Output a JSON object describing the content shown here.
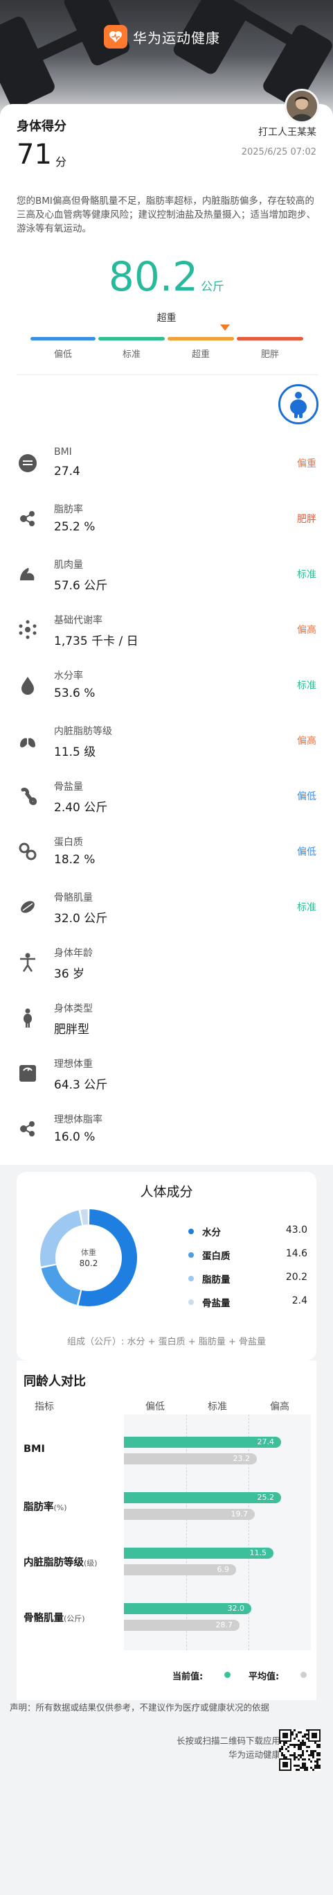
{
  "app": {
    "name": "华为运动健康"
  },
  "score": {
    "label": "身体得分",
    "value": "71",
    "unit": "分"
  },
  "user": {
    "name": "打工人王某某",
    "time": "2025/6/25 07:02"
  },
  "summary": "您的BMI偏高但骨骼肌量不足，脂肪率超标，内脏脂肪偏多，存在较高的三高及心血管病等健康风险；建议控制油盐及热量摄入；适当增加跑步、游泳等有氧运动。",
  "weight": {
    "value": "80.2",
    "unit": "公斤",
    "status": "超重",
    "scale": [
      "偏低",
      "标准",
      "超重",
      "肥胖"
    ],
    "scale_colors": [
      "#3a8ee6",
      "#2fbf8f",
      "#f0a13a",
      "#e55b3c"
    ]
  },
  "metrics": [
    {
      "name": "BMI",
      "value": "27.4",
      "tag": "偏重",
      "tag_color": "#e8764a",
      "icon": "bmi-icon"
    },
    {
      "name": "脂肪率",
      "value": "25.2 %",
      "tag": "肥胖",
      "tag_color": "#e55b3c",
      "icon": "body-fat-icon"
    },
    {
      "name": "肌肉量",
      "value": "57.6 公斤",
      "tag": "标准",
      "tag_color": "#2fbf8f",
      "icon": "muscle-icon"
    },
    {
      "name": "基础代谢率",
      "value": "1,735 千卡 / 日",
      "tag": "偏高",
      "tag_color": "#e8764a",
      "icon": "metabolism-icon"
    },
    {
      "name": "水分率",
      "value": "53.6 %",
      "tag": "标准",
      "tag_color": "#2fbf8f",
      "icon": "water-drop-icon"
    },
    {
      "name": "内脏脂肪等级",
      "value": "11.5 级",
      "tag": "偏高",
      "tag_color": "#e8764a",
      "icon": "visceral-fat-icon"
    },
    {
      "name": "骨盐量",
      "value": "2.40 公斤",
      "tag": "偏低",
      "tag_color": "#3a8ee6",
      "icon": "bone-icon"
    },
    {
      "name": "蛋白质",
      "value": "18.2 %",
      "tag": "偏低",
      "tag_color": "#3a8ee6",
      "icon": "protein-icon"
    },
    {
      "name": "骨骼肌量",
      "value": "32.0 公斤",
      "tag": "标准",
      "tag_color": "#2fbf8f",
      "icon": "skeletal-muscle-icon"
    },
    {
      "name": "身体年龄",
      "value": "36 岁",
      "tag": "",
      "tag_color": "#888888",
      "icon": "body-age-icon"
    },
    {
      "name": "身体类型",
      "value": "肥胖型",
      "tag": "",
      "tag_color": "#888888",
      "icon": "body-type-icon"
    },
    {
      "name": "理想体重",
      "value": "64.3 公斤",
      "tag": "",
      "tag_color": "#888888",
      "icon": "scale-icon"
    },
    {
      "name": "理想体脂率",
      "value": "16.0 %",
      "tag": "",
      "tag_color": "#888888",
      "icon": "body-fat-icon"
    }
  ],
  "composition": {
    "title": "人体成分",
    "center_label": "体重",
    "center_value": "80.2",
    "formula": "组成（公斤）: 水分 + 蛋白质 + 脂肪量 + 骨盐量",
    "items": [
      {
        "name": "水分",
        "value": "43.0",
        "color": "#1e7fe0"
      },
      {
        "name": "蛋白质",
        "value": "14.6",
        "color": "#4b9ee8"
      },
      {
        "name": "脂肪量",
        "value": "20.2",
        "color": "#9cc8f2"
      },
      {
        "name": "骨盐量",
        "value": "2.4",
        "color": "#c9ddf2"
      }
    ]
  },
  "peer": {
    "title": "同龄人对比",
    "headers": [
      "指标",
      "偏低",
      "标准",
      "偏高"
    ],
    "rows": [
      {
        "name": "BMI",
        "unit": "",
        "current": "27.4",
        "average": "23.2",
        "current_frac": 0.84,
        "average_frac": 0.71
      },
      {
        "name": "脂肪率",
        "unit": "(%)",
        "current": "25.2",
        "average": "19.7",
        "current_frac": 0.84,
        "average_frac": 0.7
      },
      {
        "name": "内脏脂肪等级",
        "unit": "(级)",
        "current": "11.5",
        "average": "6.9",
        "current_frac": 0.8,
        "average_frac": 0.6
      },
      {
        "name": "骨骼肌量",
        "unit": "(公斤)",
        "current": "32.0",
        "average": "28.7",
        "current_frac": 0.68,
        "average_frac": 0.62
      }
    ],
    "legend_current": "当前值:",
    "legend_average": "平均值:",
    "current_color": "#3dbf9c",
    "average_color": "#cfcfcf"
  },
  "footer": {
    "disclaimer": "声明：所有数据或结果仅供参考，不建议作为医疗或健康状况的依据",
    "qr_line1": "长按或扫描二维码下载应用",
    "qr_line2": "华为运动健康"
  }
}
